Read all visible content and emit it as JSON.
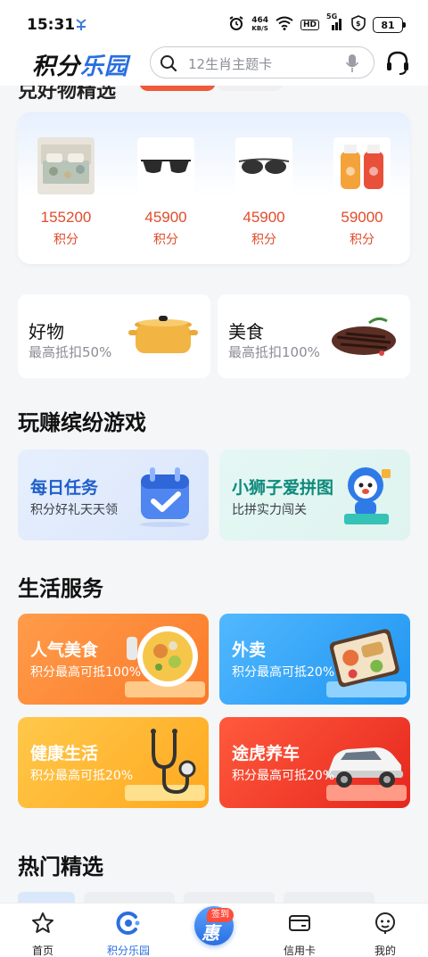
{
  "status_bar": {
    "time": "15:31",
    "carrier_icon": "app-notification-icon",
    "net_speed_value": "464",
    "net_speed_unit": "KB/S",
    "hd_label": "HD",
    "signal_label": "5G",
    "battery": "81"
  },
  "header": {
    "logo_part1": "积分",
    "logo_part2": "乐园",
    "search_placeholder": "12生肖主题卡",
    "icons": [
      "search-icon",
      "microphone-icon",
      "customer-service-icon"
    ]
  },
  "peek_section": {
    "title": "兑好物精选"
  },
  "products": [
    {
      "price": "155200",
      "unit": "积分",
      "image": "bedding-set"
    },
    {
      "price": "45900",
      "unit": "积分",
      "image": "sunglasses"
    },
    {
      "price": "45900",
      "unit": "积分",
      "image": "sunglasses"
    },
    {
      "price": "59000",
      "unit": "积分",
      "image": "shampoo-bottles"
    }
  ],
  "categories": [
    {
      "title": "好物",
      "subtitle": "最高抵扣50%",
      "image": "cooking-pot"
    },
    {
      "title": "美食",
      "subtitle": "最高抵扣100%",
      "image": "steak"
    }
  ],
  "games_section": {
    "title": "玩赚缤纷游戏",
    "cards": [
      {
        "title": "每日任务",
        "subtitle": "积分好礼天天领",
        "title_color": "#1f5fc9",
        "image": "calendar-check-icon"
      },
      {
        "title": "小狮子爱拼图",
        "subtitle": "比拼实力闯关",
        "title_color": "#0e8a7a",
        "image": "lion-mascot"
      }
    ]
  },
  "services_section": {
    "title": "生活服务",
    "cards": [
      {
        "title": "人气美食",
        "subtitle": "积分最高可抵100%",
        "image": "food-bowl"
      },
      {
        "title": "外卖",
        "subtitle": "积分最高可抵20%",
        "image": "takeout-box"
      },
      {
        "title": "健康生活",
        "subtitle": "积分最高可抵20%",
        "image": "stethoscope-icon"
      },
      {
        "title": "途虎养车",
        "subtitle": "积分最高可抵20%",
        "image": "car"
      }
    ]
  },
  "hot_section": {
    "title": "热门精选"
  },
  "tabbar": {
    "items": [
      {
        "label": "首页",
        "icon": "star-icon",
        "active": false
      },
      {
        "label": "积分乐园",
        "icon": "points-icon",
        "active": true
      },
      {
        "label": "签到",
        "icon": "sign-in-icon",
        "active": false
      },
      {
        "label": "信用卡",
        "icon": "credit-card-icon",
        "active": false
      },
      {
        "label": "我的",
        "icon": "profile-icon",
        "active": false
      }
    ],
    "sign_badge": "签到",
    "sign_glyph": "惠"
  }
}
